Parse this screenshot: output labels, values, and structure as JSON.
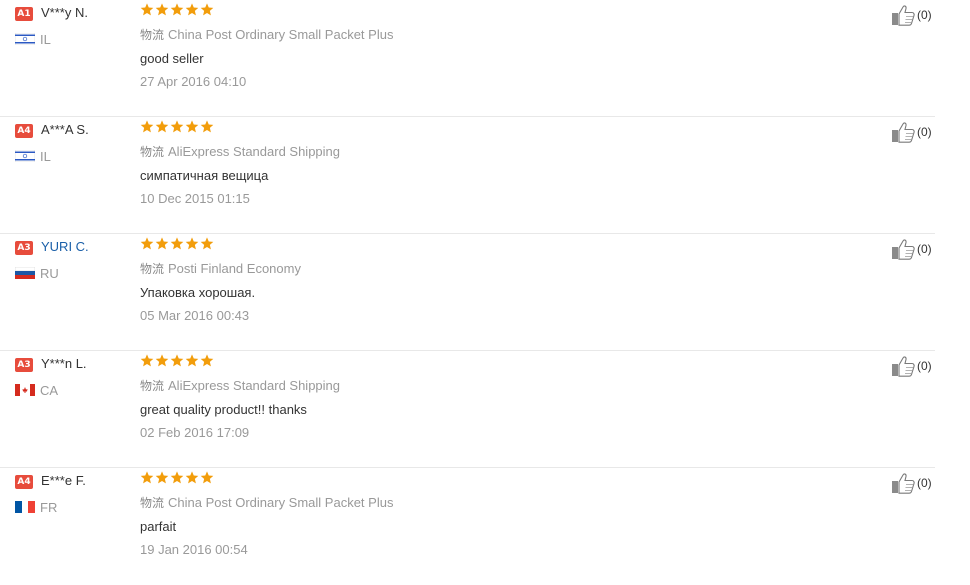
{
  "ship_label": "物流",
  "colors": {
    "star": "#f29d0b",
    "level_badge": "#e74c3c",
    "name_link": "#1a5fa8"
  },
  "reviews": [
    {
      "level": "A1",
      "name": "V***y N.",
      "name_is_link": false,
      "country": "IL",
      "flag": "flag-il-icon",
      "rating": 5,
      "shipping": "China Post Ordinary Small Packet Plus",
      "text": "good seller",
      "date": "27 Apr 2016 04:10",
      "helpful": "(0)"
    },
    {
      "level": "A4",
      "name": "A***A S.",
      "name_is_link": false,
      "country": "IL",
      "flag": "flag-il-icon",
      "rating": 5,
      "shipping": "AliExpress Standard Shipping",
      "text": "симпатичная вещица",
      "date": "10 Dec 2015 01:15",
      "helpful": "(0)"
    },
    {
      "level": "A3",
      "name": "YURI C.",
      "name_is_link": true,
      "country": "RU",
      "flag": "flag-ru-icon",
      "rating": 5,
      "shipping": "Posti Finland Economy",
      "text": "Упаковка хорошая.",
      "date": "05 Mar 2016 00:43",
      "helpful": "(0)"
    },
    {
      "level": "A3",
      "name": "Y***n L.",
      "name_is_link": false,
      "country": "CA",
      "flag": "flag-ca-icon",
      "rating": 5,
      "shipping": "AliExpress Standard Shipping",
      "text": "great quality product!! thanks",
      "date": "02 Feb 2016 17:09",
      "helpful": "(0)"
    },
    {
      "level": "A4",
      "name": "E***e F.",
      "name_is_link": false,
      "country": "FR",
      "flag": "flag-fr-icon",
      "rating": 5,
      "shipping": "China Post Ordinary Small Packet Plus",
      "text": "parfait",
      "date": "19 Jan 2016 00:54",
      "helpful": "(0)"
    }
  ]
}
